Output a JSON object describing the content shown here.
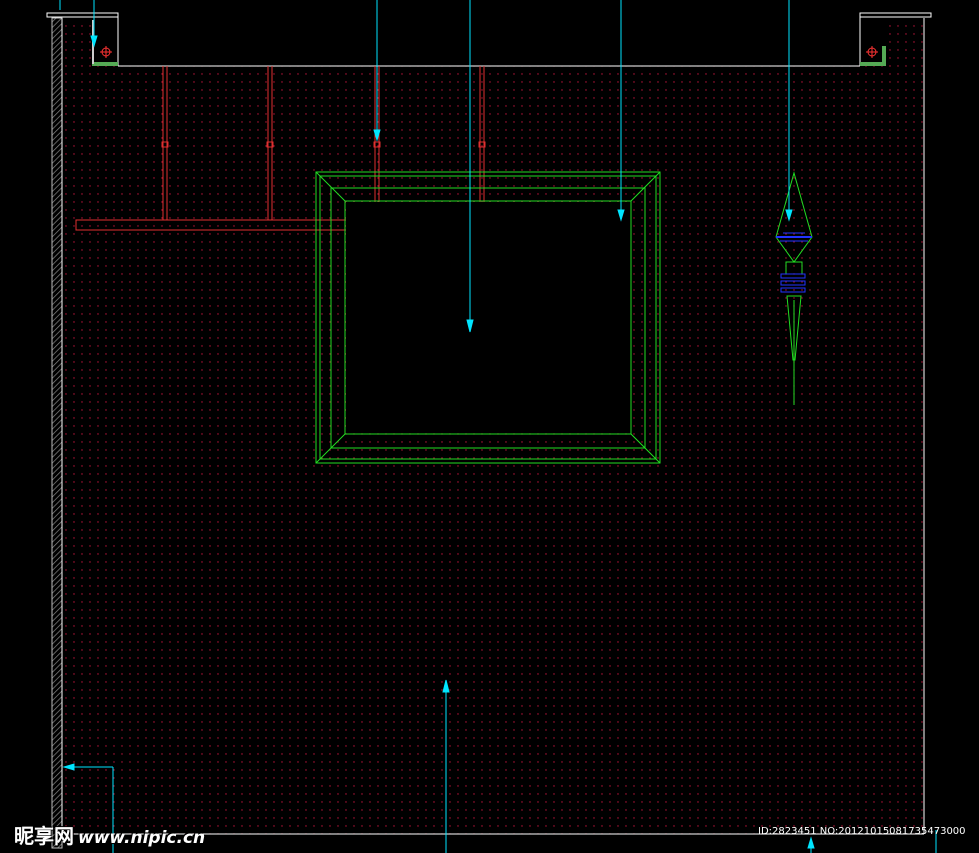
{
  "drawing": {
    "colors": {
      "background": "#000000",
      "wall_outline": "#ffffff",
      "dot_pattern": "#c0143c",
      "hatch": "#8a8a8a",
      "ceiling_hangers": "#e03030",
      "frame": "#22dd22",
      "dimension_lines": "#00e5ff",
      "lamp_body": "#22dd22",
      "lamp_details": "#2233ff"
    },
    "elements": {
      "left_column": "hatched-wall",
      "frame": "picture-frame",
      "lamp": "wall-sconce",
      "hangers": "ceiling-rods"
    }
  },
  "watermark": {
    "brand": "昵享网",
    "url": "www.nipic.cn"
  },
  "id_text": "ID:2823451 NO:20121015081735473000"
}
